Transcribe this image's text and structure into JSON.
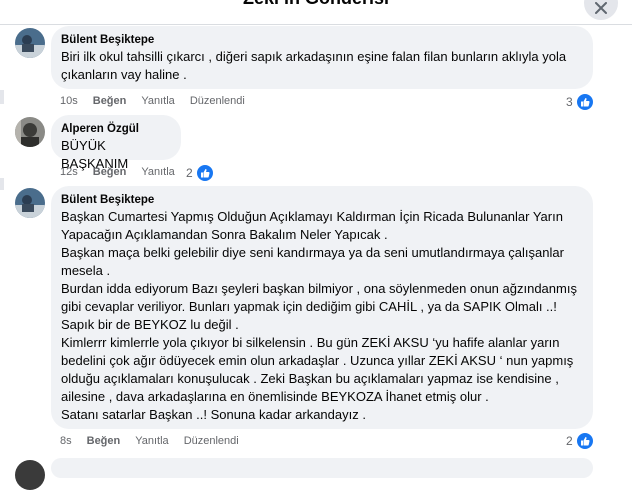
{
  "header": {
    "title": "Zeki in Gönderisi"
  },
  "comments": [
    {
      "author": "Bülent Beşiktepe",
      "text": "Biri ilk okul tahsilli çıkarcı , diğeri sapık arkadaşının eşine falan filan bunların aklıyla yola çıkanların vay haline .",
      "time": "10s",
      "like": "Beğen",
      "reply": "Yanıtla",
      "edited": "Düzenlendi",
      "reactions": "3"
    },
    {
      "author": "Alperen Özgül",
      "text": "BÜYÜK BAŞKANIM",
      "time": "12s",
      "like": "Beğen",
      "reply": "Yanıtla",
      "reactions": "2"
    },
    {
      "author": "Bülent Beşiktepe",
      "text": "Başkan Cumartesi Yapmış Olduğun Açıklamayı Kaldırman İçin Ricada Bulunanlar Yarın Yapacağın Açıklamandan Sonra Bakalım Neler Yapıcak .\nBaşkan maça belki gelebilir diye seni kandırmaya ya da seni umutlandırmaya çalışanlar mesela .\nBurdan idda ediyorum Bazı şeyleri başkan bilmiyor , ona söylenmeden onun ağzındanmış gibi cevaplar veriliyor. Bunları yapmak için dediğim gibi CAHİL , ya da SAPIK Olmalı ..! Sapık bir de BEYKOZ lu değil .\nKimlerrr kimlerrle yola çıkıyor bi silkelensin . Bu gün ZEKİ AKSU ‘yu hafife alanlar yarın bedelini çok ağır ödüyecek emin olun arkadaşlar . Uzunca yıllar ZEKİ AKSU ‘ nun yapmış olduğu açıklamaları konuşulucak . Zeki Başkan bu açıklamaları yapmaz ise kendisine , ailesine , dava arkadaşlarına en önemlisinde BEYKOZA İhanet etmiş olur .\nSatanı satarlar Başkan ..! Sonuna kadar arkandayız .",
      "time": "8s",
      "like": "Beğen",
      "reply": "Yanıtla",
      "edited": "Düzenlendi",
      "reactions": "2"
    }
  ],
  "colors": {
    "like_blue": "#1877f2",
    "bubble": "#f0f2f5",
    "meta": "#65676b"
  },
  "icons": [
    "close-icon",
    "like-icon"
  ]
}
